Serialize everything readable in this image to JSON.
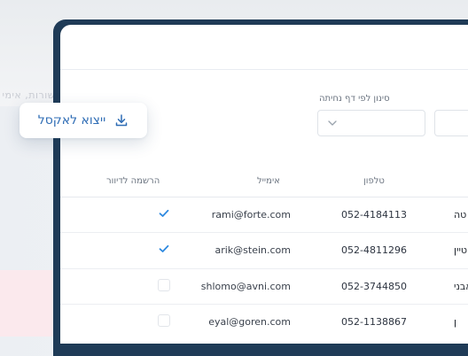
{
  "background": {
    "ghost_text": "שורות, אימי"
  },
  "filter": {
    "label": "סינון לפי דף נחיתה",
    "selected_value": ""
  },
  "export": {
    "label": "ייצוא לאקסל",
    "icon": "download-icon"
  },
  "table": {
    "headers": {
      "phone": "טלפון",
      "email": "אימייל",
      "registration": "הרשמה לדיוור"
    },
    "rows": [
      {
        "name": "טה",
        "phone": "052-4184113",
        "email": "rami@forte.com",
        "registered": true
      },
      {
        "name": "טיין",
        "phone": "052-4811296",
        "email": "arik@stein.com",
        "registered": true
      },
      {
        "name": "אבני",
        "phone": "052-3744850",
        "email": "shlomo@avni.com",
        "registered": false
      },
      {
        "name": "ן",
        "phone": "052-1138867",
        "email": "eyal@goren.com",
        "registered": false
      }
    ]
  },
  "colors": {
    "accent": "#2f6db5",
    "check": "#2f8ae0",
    "frame": "#1f3b57"
  }
}
